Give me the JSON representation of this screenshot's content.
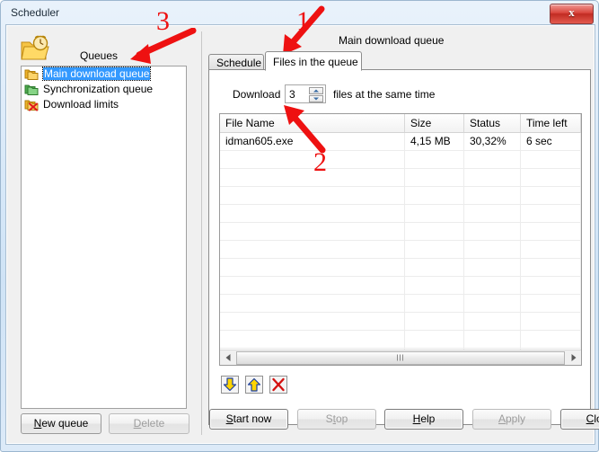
{
  "window": {
    "title": "Scheduler",
    "close_label": "x"
  },
  "left": {
    "icon": "folder-clock-icon",
    "queues_label": "Queues",
    "tree": [
      {
        "label": "Main download queue",
        "icon": "folder-yellow-icon",
        "selected": true
      },
      {
        "label": "Synchronization queue",
        "icon": "folder-green-icon",
        "selected": false
      },
      {
        "label": "Download limits",
        "icon": "folder-delete-icon",
        "selected": false
      }
    ],
    "buttons": [
      {
        "label": "New queue",
        "accel": "N",
        "disabled": false
      },
      {
        "label": "Delete",
        "accel": "D",
        "disabled": true
      }
    ]
  },
  "right": {
    "queue_title": "Main download queue",
    "tabs": [
      {
        "label": "Schedule",
        "active": false
      },
      {
        "label": "Files in the queue",
        "active": true
      }
    ],
    "download_row": {
      "prefix": "Download",
      "value": "3",
      "suffix": "files at the same time"
    },
    "file_table": {
      "columns": [
        "File Name",
        "Size",
        "Status",
        "Time left"
      ],
      "rows": [
        {
          "name": "idman605.exe",
          "size": "4,15  MB",
          "status": "30,32%",
          "time_left": "6 sec"
        }
      ],
      "empty_row_count": 13
    },
    "action_buttons": [
      {
        "icon": "move-down-icon"
      },
      {
        "icon": "move-up-icon"
      },
      {
        "icon": "delete-x-icon"
      }
    ]
  },
  "bottom_buttons": [
    {
      "label": "Start now",
      "accel": "S",
      "disabled": false,
      "default": true
    },
    {
      "label": "Stop",
      "accel": "t",
      "disabled": true,
      "default": false
    },
    {
      "label": "Help",
      "accel": "H",
      "disabled": false,
      "default": true
    },
    {
      "label": "Apply",
      "accel": "A",
      "disabled": true,
      "default": false
    },
    {
      "label": "Close",
      "accel": "C",
      "disabled": false,
      "default": true
    }
  ],
  "annotations": [
    {
      "number": "1"
    },
    {
      "number": "2"
    },
    {
      "number": "3"
    }
  ],
  "colors": {
    "selection": "#3399ff",
    "annotation": "#ee1111",
    "titlebar_top": "#e9f2fb",
    "close_red": "#d9453c"
  }
}
